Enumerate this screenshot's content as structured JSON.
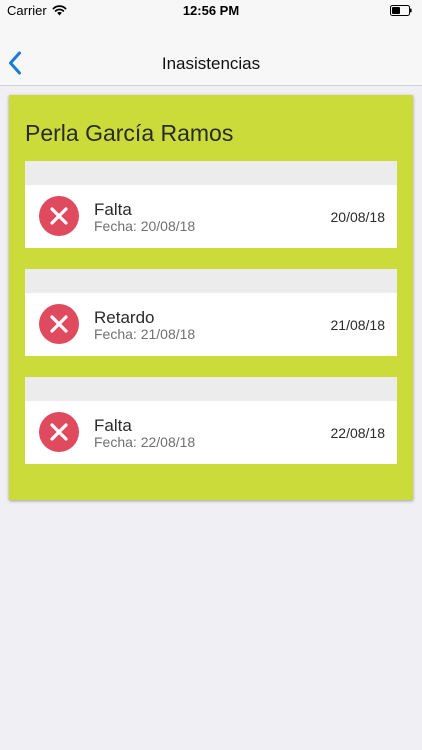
{
  "status_bar": {
    "carrier": "Carrier",
    "time": "12:56 PM"
  },
  "nav": {
    "title": "Inasistencias",
    "back_icon": "chevron-left-icon"
  },
  "card": {
    "student_name": "Perla García Ramos",
    "accent_color": "#cbdc3a"
  },
  "absences": [
    {
      "type": "Falta",
      "date_label": "Fecha:",
      "date": "20/08/18",
      "right_date": "20/08/18",
      "icon": "x-circle-icon"
    },
    {
      "type": "Retardo",
      "date_label": "Fecha:",
      "date": "21/08/18",
      "right_date": "21/08/18",
      "icon": "x-circle-icon"
    },
    {
      "type": "Falta",
      "date_label": "Fecha:",
      "date": "22/08/18",
      "right_date": "22/08/18",
      "icon": "x-circle-icon"
    }
  ],
  "colors": {
    "icon_red": "#e04a5f",
    "nav_blue": "#1a7bd9",
    "background": "#efeff4"
  }
}
